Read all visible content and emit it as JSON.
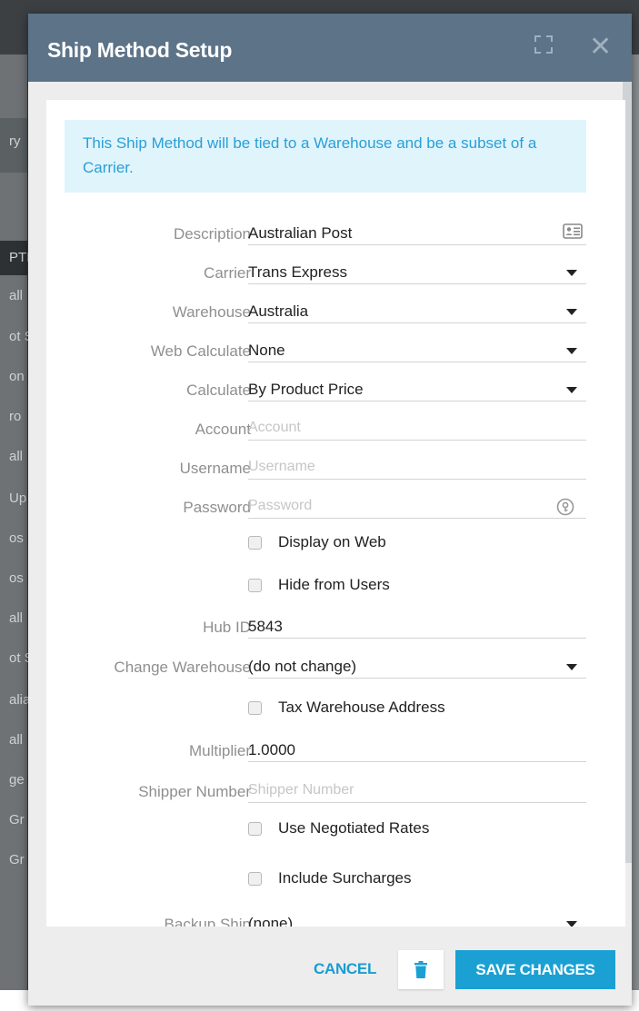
{
  "background": {
    "rows": [
      "ry",
      "PTI",
      "all",
      "ot S",
      "on",
      "ro",
      "all",
      "Up",
      "os",
      "os",
      "all",
      "ot S",
      "alia",
      "all",
      "ge",
      "Gr",
      "Gr"
    ]
  },
  "dialog": {
    "title": "Ship Method Setup",
    "info": "This Ship Method will be tied to a Warehouse and be a subset of a Carrier.",
    "fields": {
      "description": {
        "label": "Description",
        "value": "Australian Post"
      },
      "carrier": {
        "label": "Carrier",
        "value": "Trans Express"
      },
      "warehouse": {
        "label": "Warehouse",
        "value": "Australia"
      },
      "web_calculate": {
        "label": "Web Calculate",
        "value": "None"
      },
      "calculate": {
        "label": "Calculate",
        "value": "By Product Price"
      },
      "account": {
        "label": "Account",
        "placeholder": "Account"
      },
      "username": {
        "label": "Username",
        "placeholder": "Username"
      },
      "password": {
        "label": "Password",
        "placeholder": "Password"
      },
      "display_on_web": {
        "label": "Display on Web",
        "checked": false
      },
      "hide_from_users": {
        "label": "Hide from Users",
        "checked": false
      },
      "hub_id": {
        "label": "Hub ID",
        "value": "5843"
      },
      "change_warehouse": {
        "label": "Change Warehouse",
        "value": "(do not change)"
      },
      "tax_warehouse_address": {
        "label": "Tax Warehouse Address",
        "checked": false
      },
      "multiplier": {
        "label": "Multiplier",
        "value": "1.0000"
      },
      "shipper_number": {
        "label": "Shipper Number",
        "placeholder": "Shipper Number"
      },
      "use_negotiated_rates": {
        "label": "Use Negotiated Rates",
        "checked": false
      },
      "include_surcharges": {
        "label": "Include Surcharges",
        "checked": false
      },
      "backup_ship": {
        "label": "Backup Ship",
        "value": "(none)"
      }
    },
    "footer": {
      "cancel_label": "CANCEL",
      "save_label": "SAVE CHANGES"
    },
    "icons": [
      "expand-icon",
      "close-icon",
      "contact-card-icon",
      "password-key-icon",
      "trash-icon",
      "dropdown-caret-icon"
    ],
    "colors": {
      "header": "#5c7388",
      "accent": "#1ba0d4",
      "info_bg": "#e0f4fc",
      "info_text": "#2a9fd6"
    }
  }
}
